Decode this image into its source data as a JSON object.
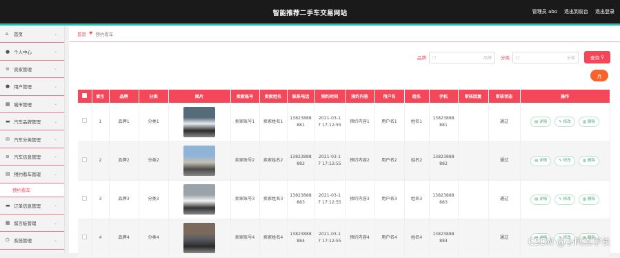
{
  "header": {
    "title": "智能推荐二手车交易网站",
    "admin": "管理员 abo",
    "back_link": "退出到前台",
    "logout": "退出登录"
  },
  "sidebar": {
    "items": [
      {
        "label": "首页",
        "icon": "home-icon",
        "glyph": "⌂"
      },
      {
        "label": "个人中心",
        "icon": "user-icon",
        "glyph": "●"
      },
      {
        "label": "卖家管理",
        "icon": "list-icon",
        "glyph": "≡"
      },
      {
        "label": "用户管理",
        "icon": "user-icon",
        "glyph": "●"
      },
      {
        "label": "城市管理",
        "icon": "grid-icon",
        "glyph": "▦"
      },
      {
        "label": "汽车品牌管理",
        "icon": "car-icon",
        "glyph": "▬"
      },
      {
        "label": "汽车分类管理",
        "icon": "mail-icon",
        "glyph": "✉"
      },
      {
        "label": "汽车信息管理",
        "icon": "list-icon",
        "glyph": "≡"
      },
      {
        "label": "预约看车管理",
        "icon": "doc-icon",
        "glyph": "▤"
      }
    ],
    "sub_item": "预约看车",
    "items_after": [
      {
        "label": "订单信息管理",
        "icon": "order-icon",
        "glyph": "▬"
      },
      {
        "label": "留言板管理",
        "icon": "message-icon",
        "glyph": "▦"
      },
      {
        "label": "系统管理",
        "icon": "power-icon",
        "glyph": "⏻"
      }
    ]
  },
  "breadcrumb": {
    "home": "首页",
    "current": "预约看车"
  },
  "search": {
    "brand_label": "品牌",
    "brand_placeholder": "品牌",
    "category_label": "分类",
    "category_placeholder": "分类",
    "button": "查询"
  },
  "add_button": "月",
  "table": {
    "headers": [
      "索引",
      "品牌",
      "分类",
      "图片",
      "卖家账号",
      "卖家姓名",
      "联系电话",
      "预约时间",
      "预约内容",
      "用户名",
      "姓名",
      "手机",
      "审核回复",
      "审核状态",
      "操作"
    ],
    "actions": {
      "detail": "详情",
      "edit": "修改",
      "delete": "删除"
    },
    "rows": [
      {
        "index": "1",
        "brand": "品牌1",
        "category": "分类1",
        "seller_account": "卖家账号1",
        "seller_name": "卖家姓名1",
        "phone_a": "13823888",
        "phone_b": "881",
        "time_a": "2021-03-1",
        "time_b": "7 17:12:55",
        "content": "预约内容1",
        "username": "用户名1",
        "name": "姓名1",
        "mobile_a": "13823888",
        "mobile_b": "881",
        "reply": "",
        "status": "通过",
        "photo_colors": [
          "#556b7a",
          "#e8ecee",
          "#2c2c2c"
        ]
      },
      {
        "index": "2",
        "brand": "品牌2",
        "category": "分类2",
        "seller_account": "卖家账号2",
        "seller_name": "卖家姓名2",
        "phone_a": "13823888",
        "phone_b": "882",
        "time_a": "2021-03-1",
        "time_b": "7 17:12:55",
        "content": "预约内容2",
        "username": "用户名2",
        "name": "姓名2",
        "mobile_a": "13823888",
        "mobile_b": "882",
        "reply": "",
        "status": "通过",
        "photo_colors": [
          "#8fb4d6",
          "#c8c0b2",
          "#4a4a4a"
        ]
      },
      {
        "index": "3",
        "brand": "品牌3",
        "category": "分类3",
        "seller_account": "卖家账号3",
        "seller_name": "卖家姓名3",
        "phone_a": "13823888",
        "phone_b": "883",
        "time_a": "2021-03-1",
        "time_b": "7 17:12:55",
        "content": "预约内容3",
        "username": "用户名3",
        "name": "姓名3",
        "mobile_a": "13823888",
        "mobile_b": "883",
        "reply": "",
        "status": "通过",
        "photo_colors": [
          "#9aa3a8",
          "#f2f2f2",
          "#333333"
        ]
      },
      {
        "index": "4",
        "brand": "品牌4",
        "category": "分类4",
        "seller_account": "卖家账号4",
        "seller_name": "卖家姓名4",
        "phone_a": "13823888",
        "phone_b": "884",
        "time_a": "2021-03-1",
        "time_b": "7 17:12:55",
        "content": "预约内容4",
        "username": "用户名4",
        "name": "姓名4",
        "mobile_a": "13823888",
        "mobile_b": "884",
        "reply": "",
        "status": "通过",
        "photo_colors": [
          "#7a6a5c",
          "#555a60",
          "#2a2a2a"
        ]
      }
    ]
  },
  "watermark": "CSDN @小阿杰学长",
  "colors": {
    "accent": "#f5475a",
    "topbar": "#1a1a1a",
    "teal": "#2bbbad",
    "add_button": "#f9622b"
  }
}
